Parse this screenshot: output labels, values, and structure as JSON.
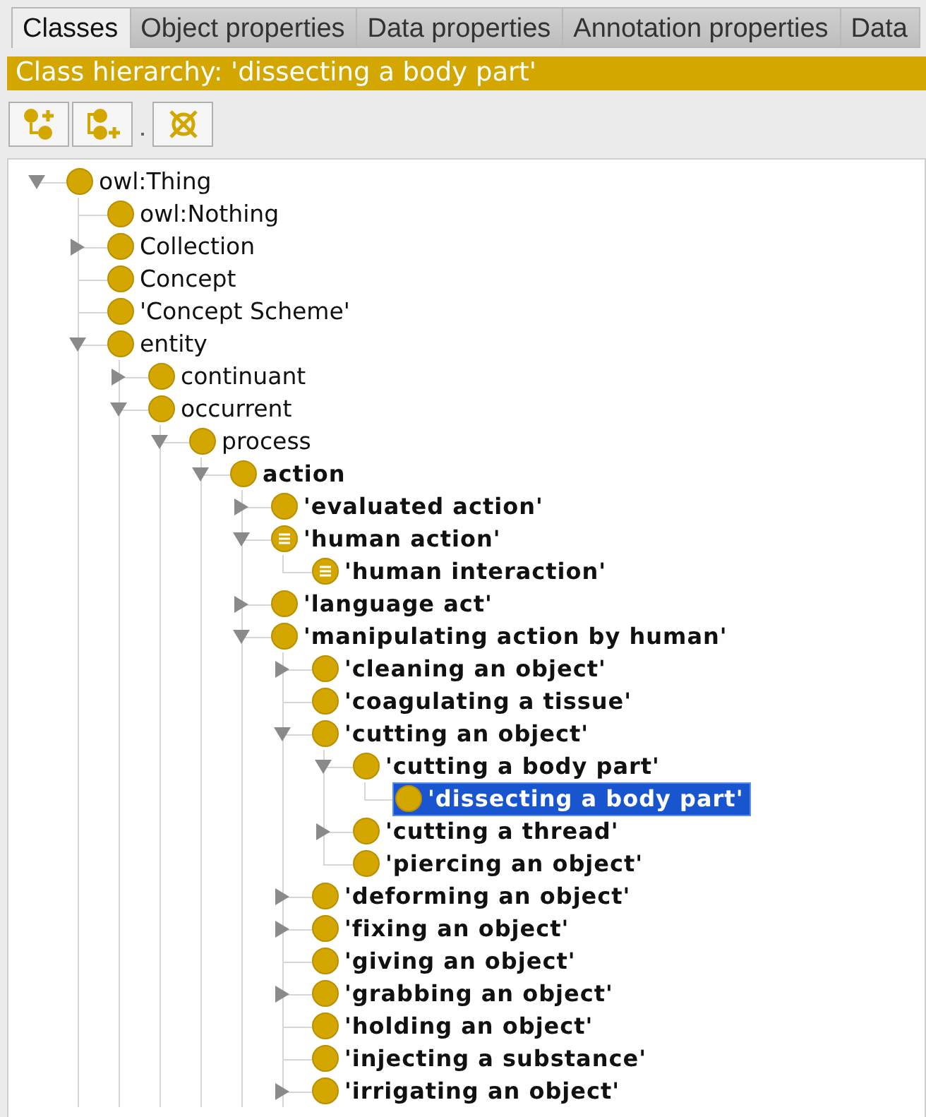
{
  "tabs": [
    {
      "label": "Classes",
      "selected": true
    },
    {
      "label": "Object properties",
      "selected": false
    },
    {
      "label": "Data properties",
      "selected": false
    },
    {
      "label": "Annotation properties",
      "selected": false
    },
    {
      "label": "Data",
      "selected": false
    }
  ],
  "panel_title": "Class hierarchy: 'dissecting a body part'",
  "toolbar": [
    {
      "kind": "add-subclass"
    },
    {
      "kind": "add-sibling"
    },
    {
      "kind": "separator"
    },
    {
      "kind": "delete"
    }
  ],
  "tree": [
    {
      "label": "owl:Thing",
      "kind": "primitive",
      "bold": false,
      "selected": false,
      "expanded": true,
      "children": [
        {
          "label": "owl:Nothing",
          "kind": "primitive",
          "bold": false,
          "selected": false
        },
        {
          "label": "Collection",
          "kind": "primitive",
          "bold": false,
          "selected": false,
          "expanded": false
        },
        {
          "label": "Concept",
          "kind": "primitive",
          "bold": false,
          "selected": false
        },
        {
          "label": "'Concept Scheme'",
          "kind": "primitive",
          "bold": false,
          "selected": false
        },
        {
          "label": "entity",
          "kind": "primitive",
          "bold": false,
          "selected": false,
          "expanded": true,
          "children": [
            {
              "label": "continuant",
              "kind": "primitive",
              "bold": false,
              "selected": false,
              "expanded": false
            },
            {
              "label": "occurrent",
              "kind": "primitive",
              "bold": false,
              "selected": false,
              "expanded": true,
              "children": [
                {
                  "label": "process",
                  "kind": "primitive",
                  "bold": false,
                  "selected": false,
                  "expanded": true,
                  "children": [
                    {
                      "label": "action",
                      "kind": "primitive",
                      "bold": true,
                      "selected": false,
                      "expanded": true,
                      "children": [
                        {
                          "label": "'evaluated action'",
                          "kind": "primitive",
                          "bold": true,
                          "selected": false,
                          "expanded": false
                        },
                        {
                          "label": "'human action'",
                          "kind": "defined",
                          "bold": true,
                          "selected": false,
                          "expanded": true,
                          "children": [
                            {
                              "label": "'human interaction'",
                              "kind": "defined",
                              "bold": true,
                              "selected": false
                            }
                          ]
                        },
                        {
                          "label": "'language act'",
                          "kind": "primitive",
                          "bold": true,
                          "selected": false,
                          "expanded": false
                        },
                        {
                          "label": "'manipulating action by human'",
                          "kind": "primitive",
                          "bold": true,
                          "selected": false,
                          "expanded": true,
                          "children": [
                            {
                              "label": "'cleaning an object'",
                              "kind": "primitive",
                              "bold": true,
                              "selected": false,
                              "expanded": false
                            },
                            {
                              "label": "'coagulating a tissue'",
                              "kind": "primitive",
                              "bold": true,
                              "selected": false
                            },
                            {
                              "label": "'cutting an object'",
                              "kind": "primitive",
                              "bold": true,
                              "selected": false,
                              "expanded": true,
                              "children": [
                                {
                                  "label": "'cutting a body part'",
                                  "kind": "primitive",
                                  "bold": true,
                                  "selected": false,
                                  "expanded": true,
                                  "children": [
                                    {
                                      "label": "'dissecting a body part'",
                                      "kind": "primitive",
                                      "bold": true,
                                      "selected": true
                                    }
                                  ]
                                },
                                {
                                  "label": "'cutting a thread'",
                                  "kind": "primitive",
                                  "bold": true,
                                  "selected": false,
                                  "expanded": false
                                },
                                {
                                  "label": "'piercing an object'",
                                  "kind": "primitive",
                                  "bold": true,
                                  "selected": false
                                }
                              ]
                            },
                            {
                              "label": "'deforming an object'",
                              "kind": "primitive",
                              "bold": true,
                              "selected": false,
                              "expanded": false
                            },
                            {
                              "label": "'fixing an object'",
                              "kind": "primitive",
                              "bold": true,
                              "selected": false,
                              "expanded": false
                            },
                            {
                              "label": "'giving an object'",
                              "kind": "primitive",
                              "bold": true,
                              "selected": false
                            },
                            {
                              "label": "'grabbing an object'",
                              "kind": "primitive",
                              "bold": true,
                              "selected": false,
                              "expanded": false
                            },
                            {
                              "label": "'holding an object'",
                              "kind": "primitive",
                              "bold": true,
                              "selected": false
                            },
                            {
                              "label": "'injecting a substance'",
                              "kind": "primitive",
                              "bold": true,
                              "selected": false
                            },
                            {
                              "label": "'irrigating an object'",
                              "kind": "primitive",
                              "bold": true,
                              "selected": false,
                              "expanded": false
                            }
                          ]
                        }
                      ]
                    }
                  ]
                }
              ]
            }
          ]
        }
      ]
    }
  ]
}
